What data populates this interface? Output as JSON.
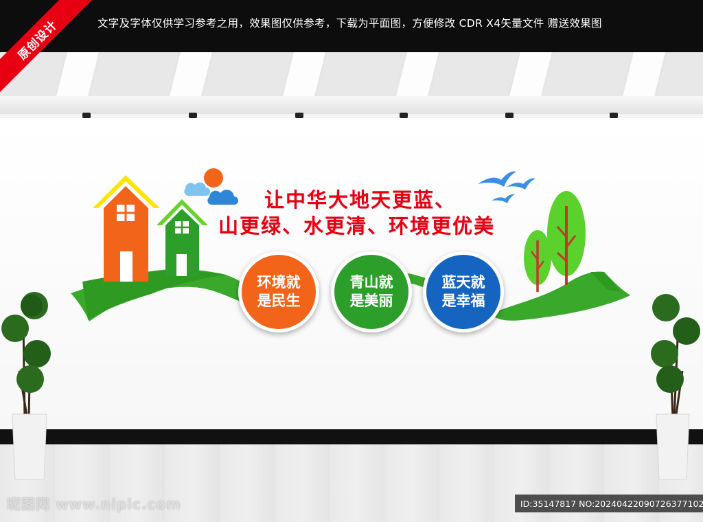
{
  "header": {
    "notice": "文字及字体仅供学习参考之用，效果图仅供参考，下载为平面图，方便修改    CDR X4矢量文件  赠送效果图"
  },
  "badge": {
    "label": "原创设计"
  },
  "slogan": {
    "line1": "让中华大地天更蓝、",
    "line2": "山更绿、水更清、环境更优美"
  },
  "circles": [
    {
      "line1": "环境就",
      "line2": "是民生",
      "color": "#f26419"
    },
    {
      "line1": "青山就",
      "line2": "是美丽",
      "color": "#2c9e2a"
    },
    {
      "line1": "蓝天就",
      "line2": "是幸福",
      "color": "#1565c0"
    }
  ],
  "footer": {
    "watermark": "昵图网 www.nipic.com",
    "id_text": "ID:35147817 NO:20240422090726377102"
  },
  "colors": {
    "brand_red": "#e60012",
    "orange": "#f26419",
    "green": "#2c9e2a",
    "blue": "#1565c0",
    "lime": "#5bd12e",
    "sky": "#3a8ee6"
  }
}
